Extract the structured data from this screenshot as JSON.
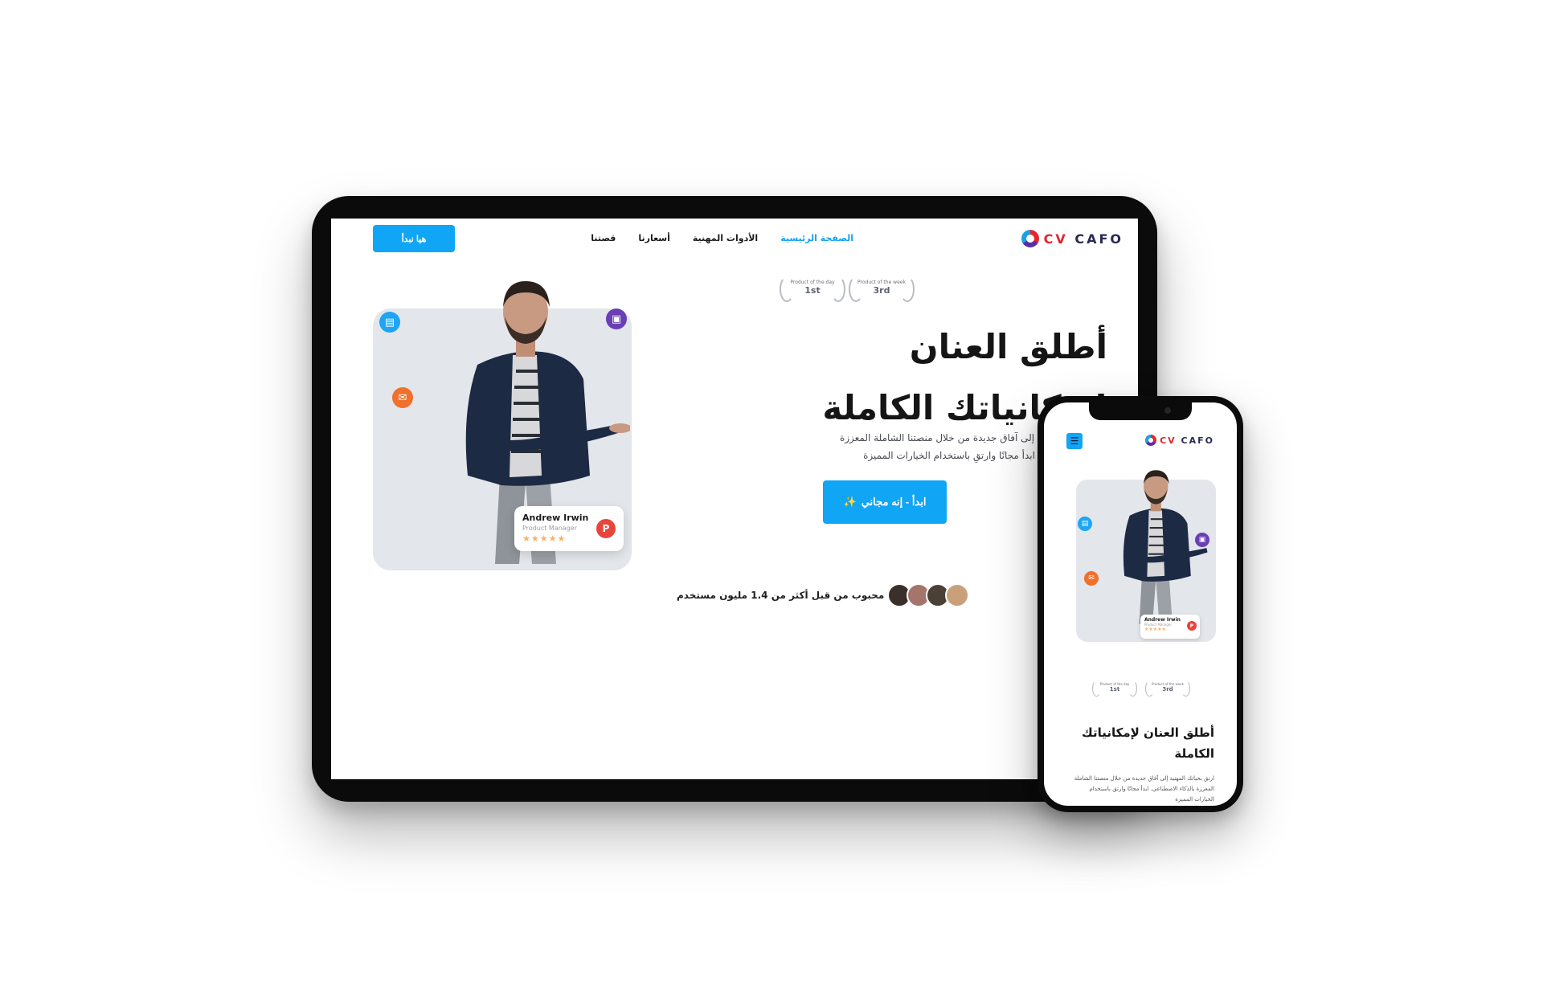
{
  "brand": {
    "logo_cv": "CV",
    "logo_rest": "CAFO"
  },
  "nav": {
    "items": [
      "الصفحة الرئيسية",
      "الأدوات المهنية",
      "أسعارنا",
      "قصتنا"
    ],
    "cta": "هيا نبدأ"
  },
  "badges": [
    {
      "caption": "Product of the week",
      "rank": "3rd"
    },
    {
      "caption": "Product of the day",
      "rank": "1st"
    }
  ],
  "hero": {
    "title_line1": "أطلق العنان",
    "title_line2": "لإمكانياتك الكاملة",
    "description": "ارتق بحياتك المهنية إلى آفاق جديدة من خلال منصتنا الشاملة المعززة بالذكاء الاصطناعي. ابدأ مجانًا وارتقِ باستخدام الخيارات المميزة",
    "cta": "ابدأ - إنه مجاني",
    "cta_emoji": "✨",
    "loved_by": "محبوب من قبل أكثر من 1.4 مليون مستخدم"
  },
  "profile_card": {
    "name": "Andrew Irwin",
    "role": "Product Manager",
    "stars": "★★★★★",
    "company_initial": "P"
  },
  "phone": {
    "title": "أطلق العنان لإمكانياتك الكاملة",
    "description": "ارتق بحياتك المهنية إلى آفاق جديدة من خلال منصتنا الشاملة المعززة بالذكاء الاصطناعي. ابدأ مجانًا وارتق باستخدام الخيارات المميزة",
    "profile_name": "Andrew Irwin",
    "profile_role": "Product Manager",
    "menu_icon": "☰"
  },
  "colors": {
    "accent": "#10a5f5",
    "brand_red": "#e0262d",
    "brand_navy": "#2a2b55",
    "card_bg": "#e3e6ea"
  },
  "icons": [
    "document-icon",
    "monitor-icon",
    "mail-icon",
    "menu-icon",
    "chevron-right-icon",
    "laurel-icon"
  ]
}
